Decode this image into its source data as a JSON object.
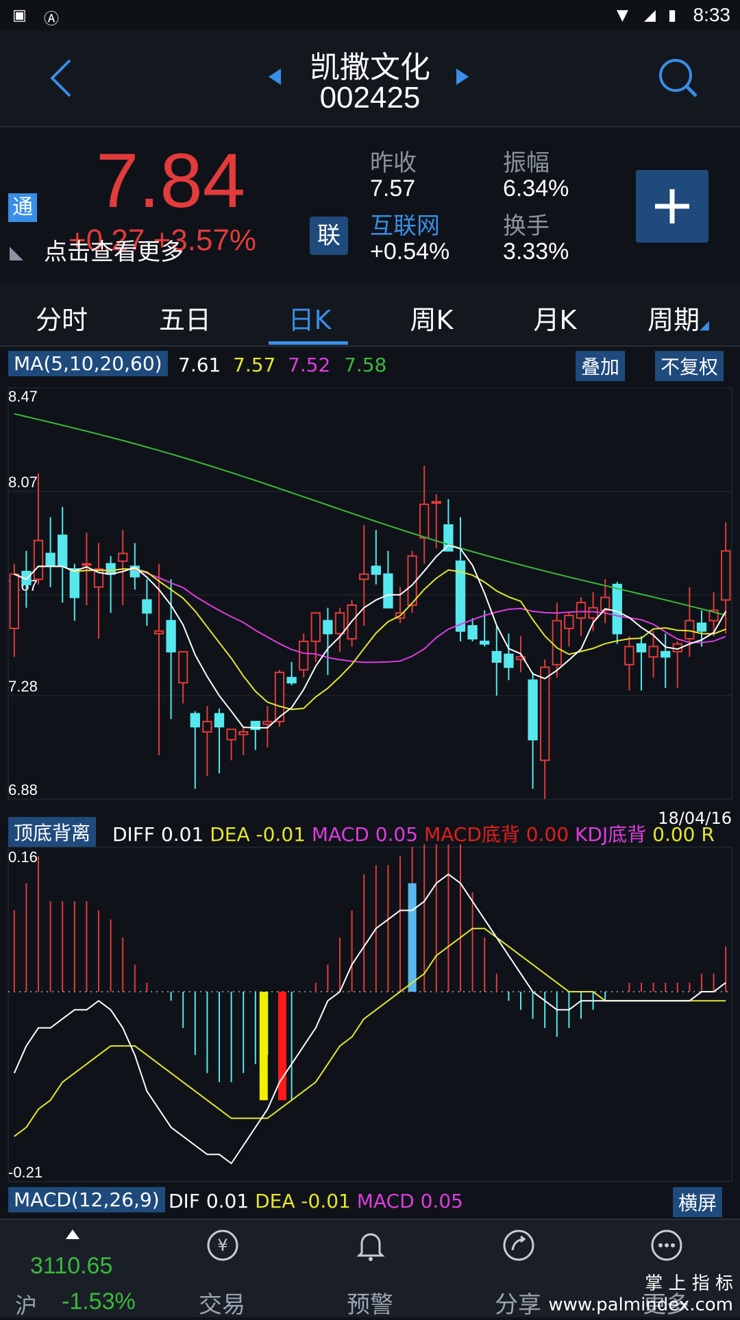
{
  "status_bar": {
    "time": "8:33"
  },
  "header": {
    "name": "凯撒文化",
    "code": "002425"
  },
  "quote": {
    "price": "7.84",
    "change": "+0.27",
    "change_pct": "+3.57%",
    "tong_badge": "通",
    "lian_badge": "联",
    "more_text": "点击查看更多",
    "prev_close_label": "昨收",
    "prev_close": "7.57",
    "sector_label": "互联网",
    "sector_change": "+0.54%",
    "amplitude_label": "振幅",
    "amplitude": "6.34%",
    "turnover_label": "换手",
    "turnover": "3.33%"
  },
  "tabs": [
    "分时",
    "五日",
    "日K",
    "周K",
    "月K",
    "周期"
  ],
  "active_tab": "日K",
  "ma_bar": {
    "label": "MA(5,10,20,60)",
    "values": [
      "7.61",
      "7.57",
      "7.52",
      "7.58"
    ],
    "overlay_button": "叠加",
    "adjust_button": "不复权"
  },
  "kline": {
    "y_ticks": [
      "8.47",
      "8.07",
      "7.67",
      "7.28",
      "6.88"
    ],
    "ylim": [
      6.88,
      8.47
    ],
    "candles": [
      [
        7.54,
        7.79,
        7.43,
        7.75
      ],
      [
        7.76,
        7.84,
        7.62,
        7.71
      ],
      [
        7.73,
        8.14,
        7.71,
        7.88
      ],
      [
        7.83,
        7.97,
        7.7,
        7.78
      ],
      [
        7.9,
        8.01,
        7.64,
        7.78
      ],
      [
        7.77,
        7.79,
        7.57,
        7.66
      ],
      [
        7.79,
        7.91,
        7.63,
        7.79
      ],
      [
        7.7,
        7.87,
        7.5,
        7.77
      ],
      [
        7.79,
        7.82,
        7.6,
        7.75
      ],
      [
        7.8,
        7.92,
        7.63,
        7.83
      ],
      [
        7.78,
        7.87,
        7.69,
        7.74
      ],
      [
        7.65,
        7.73,
        7.55,
        7.6
      ],
      [
        7.52,
        7.79,
        7.05,
        7.53
      ],
      [
        7.57,
        7.73,
        7.19,
        7.45
      ],
      [
        7.33,
        7.43,
        7.25,
        7.45
      ],
      [
        7.21,
        7.22,
        6.92,
        7.16
      ],
      [
        7.14,
        7.24,
        6.97,
        7.18
      ],
      [
        7.21,
        7.23,
        6.98,
        7.16
      ],
      [
        7.11,
        7.14,
        7.03,
        7.15
      ],
      [
        7.13,
        7.16,
        7.05,
        7.14
      ],
      [
        7.18,
        7.18,
        7.07,
        7.15
      ],
      [
        7.17,
        7.24,
        7.08,
        7.18
      ],
      [
        7.18,
        7.38,
        7.16,
        7.37
      ],
      [
        7.35,
        7.41,
        7.32,
        7.33
      ],
      [
        7.38,
        7.52,
        7.35,
        7.49
      ],
      [
        7.49,
        7.6,
        7.41,
        7.6
      ],
      [
        7.57,
        7.62,
        7.36,
        7.52
      ],
      [
        7.52,
        7.62,
        7.45,
        7.6
      ],
      [
        7.5,
        7.65,
        7.47,
        7.63
      ],
      [
        7.73,
        7.94,
        7.55,
        7.75
      ],
      [
        7.78,
        7.92,
        7.71,
        7.75
      ],
      [
        7.75,
        7.84,
        7.66,
        7.62
      ],
      [
        7.58,
        7.7,
        7.56,
        7.6
      ],
      [
        7.63,
        7.84,
        7.6,
        7.82
      ],
      [
        7.89,
        8.17,
        7.79,
        8.02
      ],
      [
        8.03,
        8.06,
        7.85,
        8.03
      ],
      [
        7.94,
        8.04,
        7.85,
        7.84
      ],
      [
        7.8,
        7.97,
        7.49,
        7.53
      ],
      [
        7.55,
        7.58,
        7.49,
        7.5
      ],
      [
        7.49,
        7.61,
        7.47,
        7.48
      ],
      [
        7.45,
        7.55,
        7.28,
        7.41
      ],
      [
        7.44,
        7.52,
        7.34,
        7.39
      ],
      [
        7.42,
        7.51,
        7.37,
        7.43
      ],
      [
        7.34,
        7.37,
        6.92,
        7.11
      ],
      [
        7.03,
        7.42,
        6.88,
        7.39
      ],
      [
        7.4,
        7.64,
        7.35,
        7.57
      ],
      [
        7.54,
        7.6,
        7.47,
        7.59
      ],
      [
        7.58,
        7.66,
        7.51,
        7.64
      ],
      [
        7.58,
        7.68,
        7.53,
        7.62
      ],
      [
        7.61,
        7.73,
        7.56,
        7.66
      ],
      [
        7.71,
        7.72,
        7.48,
        7.52
      ],
      [
        7.4,
        7.51,
        7.3,
        7.47
      ],
      [
        7.48,
        7.51,
        7.3,
        7.45
      ],
      [
        7.43,
        7.53,
        7.35,
        7.47
      ],
      [
        7.45,
        7.52,
        7.31,
        7.43
      ],
      [
        7.45,
        7.49,
        7.31,
        7.48
      ],
      [
        7.5,
        7.7,
        7.43,
        7.57
      ],
      [
        7.56,
        7.61,
        7.47,
        7.53
      ],
      [
        7.57,
        7.68,
        7.51,
        7.61
      ],
      [
        7.65,
        7.95,
        7.52,
        7.84
      ]
    ],
    "last_date": "18/04/16"
  },
  "macd_bar": {
    "badge": "顶底背离",
    "diff_label": "DIFF",
    "diff": "0.01",
    "dea_label": "DEA",
    "dea": "-0.01",
    "macd_label": "MACD",
    "macd": "0.05",
    "top_div_label": "MACD底背",
    "top_div": "0.00",
    "kdj_label": "KDJ底背",
    "kdj": "0.00",
    "suffix": "R",
    "date": "18/04/16"
  },
  "macd_chart": {
    "y_ticks": [
      "0.16",
      "-0.21"
    ],
    "ylim": [
      -0.21,
      0.16
    ],
    "hist": [
      0.09,
      0.12,
      0.15,
      0.1,
      0.1,
      0.1,
      0.1,
      0.09,
      0.08,
      0.06,
      0.03,
      0.01,
      0.0,
      -0.01,
      -0.04,
      -0.07,
      -0.09,
      -0.1,
      -0.1,
      -0.09,
      -0.08,
      -0.07,
      -0.12,
      -0.12,
      0.0,
      0.01,
      0.03,
      0.06,
      0.09,
      0.13,
      0.14,
      0.14,
      0.15,
      0.16,
      0.18,
      0.21,
      0.22,
      0.17,
      0.11,
      0.06,
      0.02,
      -0.01,
      -0.02,
      -0.03,
      -0.04,
      -0.05,
      -0.04,
      -0.03,
      -0.02,
      -0.01,
      0.0,
      0.01,
      0.01,
      0.01,
      0.01,
      0.01,
      0.01,
      0.02,
      0.02,
      0.05
    ],
    "diff": [
      -0.09,
      -0.06,
      -0.04,
      -0.04,
      -0.03,
      -0.02,
      -0.02,
      -0.01,
      -0.02,
      -0.04,
      -0.07,
      -0.11,
      -0.13,
      -0.15,
      -0.16,
      -0.17,
      -0.18,
      -0.18,
      -0.19,
      -0.17,
      -0.15,
      -0.13,
      -0.1,
      -0.08,
      -0.06,
      -0.04,
      -0.01,
      0.0,
      0.03,
      0.05,
      0.07,
      0.08,
      0.09,
      0.09,
      0.1,
      0.12,
      0.13,
      0.12,
      0.1,
      0.08,
      0.06,
      0.04,
      0.02,
      0.0,
      -0.01,
      -0.02,
      -0.02,
      -0.01,
      -0.01,
      -0.01,
      -0.01,
      -0.01,
      -0.01,
      -0.01,
      -0.01,
      -0.01,
      -0.01,
      0.0,
      0.0,
      0.01
    ],
    "dea": [
      -0.16,
      -0.15,
      -0.13,
      -0.12,
      -0.1,
      -0.09,
      -0.08,
      -0.07,
      -0.06,
      -0.06,
      -0.06,
      -0.07,
      -0.08,
      -0.09,
      -0.1,
      -0.11,
      -0.12,
      -0.13,
      -0.14,
      -0.14,
      -0.14,
      -0.14,
      -0.13,
      -0.12,
      -0.11,
      -0.1,
      -0.08,
      -0.06,
      -0.05,
      -0.03,
      -0.02,
      -0.01,
      0.0,
      0.01,
      0.02,
      0.04,
      0.05,
      0.06,
      0.07,
      0.07,
      0.06,
      0.05,
      0.04,
      0.03,
      0.02,
      0.01,
      0.0,
      0.0,
      0.0,
      -0.01,
      -0.01,
      -0.01,
      -0.01,
      -0.01,
      -0.01,
      -0.01,
      -0.01,
      -0.01,
      -0.01,
      -0.01
    ]
  },
  "bottom_indicator": {
    "label": "MACD(12,26,9)",
    "dif_label": "DIF",
    "dif": "0.01",
    "dea_label": "DEA",
    "dea": "-0.01",
    "macd_label": "MACD",
    "macd": "0.05",
    "landscape_button": "横屏"
  },
  "index_ticker": {
    "value": "3110.65",
    "market": "沪",
    "change_pct": "-1.53%"
  },
  "nav": [
    "交易",
    "预警",
    "分享",
    "更多"
  ],
  "watermark": "掌 上 指 标 www.palmindex.com",
  "colors": {
    "up": "#e23b3b",
    "down": "#56e8ef",
    "accent": "#3a8ee6",
    "ma5": "#ffffff",
    "ma10": "#e6e62e",
    "ma20": "#e03be0",
    "ma60": "#3bb83b"
  }
}
